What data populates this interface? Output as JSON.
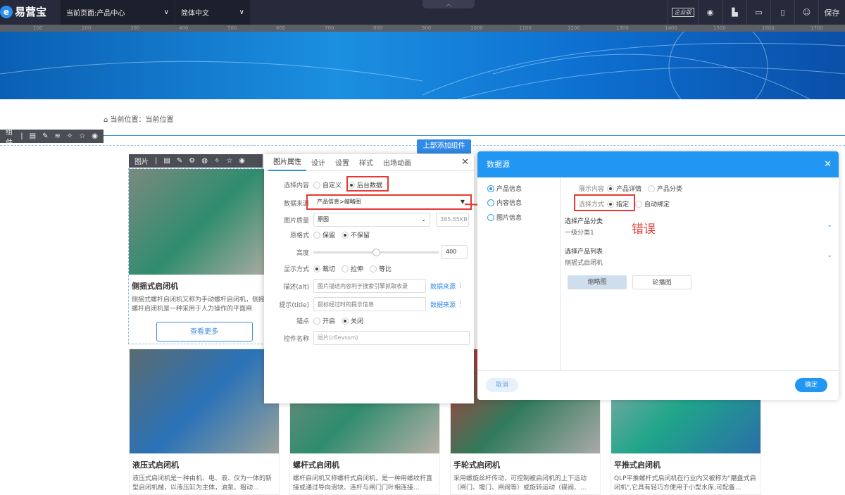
{
  "topbar": {
    "logo": "易营宝",
    "page_select": "当前页面:产品中心",
    "lang_select": "简体中文",
    "edition": "企业版",
    "save": "保存"
  },
  "ruler": [
    "100",
    "200",
    "300",
    "400",
    "500",
    "600",
    "700",
    "800",
    "900",
    "1000",
    "1100",
    "1200",
    "1300",
    "1400",
    "1500",
    "1600",
    "1700"
  ],
  "breadcrumb": "当前位置：当前位置",
  "component_toolbar": {
    "label": "组件"
  },
  "add_top_button": "上部添加组件",
  "image_toolbar": {
    "label": "图片"
  },
  "cards": [
    {
      "title": "侧摇式启闭机",
      "desc": "侧摇式螺杆启闭机又称为手动螺杆启闭机，侧摇式螺杆启闭机是一种采用于人力操作的平面闸",
      "more": "查看更多"
    },
    {
      "title": "液压式启闭机",
      "desc": "液压式启闭机是一种由机、电、液、仪为一体的新型启闭机械，以液压缸为主体，油泵、粗动..."
    },
    {
      "title": "螺杆式启闭机",
      "desc": "螺杆启闭机又称螺杆式启闭机，是一种用螺纹杆直接或通过导向滑块、连杆与闸门门叶相连接..."
    },
    {
      "title": "手轮式启闭机",
      "desc": "采用螺旋丝杆传动，可控制被启闭机的上下运动（闸门、堰门、闸阀等）或旋转运动（碟阀、..."
    },
    {
      "title": "平推式启闭机",
      "desc": "QLP平推螺杆式启闭机在行业内又被称为\"磨盘式启闭机\",它具有轻巧方便用于小型水库,可配备..."
    }
  ],
  "panel": {
    "tabs": [
      "图片属性",
      "设计",
      "设置",
      "样式",
      "出场动画"
    ],
    "content_label": "选择内容",
    "content_opts": [
      "自定义",
      "后台数据"
    ],
    "source_label": "数据来源",
    "source_value": "产品信息>缩略图",
    "quality_label": "图片质量",
    "quality_value": "原图",
    "size": "385.55KB",
    "format_label": "原格式",
    "format_opts": [
      "保留",
      "不保留"
    ],
    "height_label": "高度",
    "height_value": "400",
    "height_fraction": 0.5,
    "display_label": "显示方式",
    "display_opts": [
      "裁切",
      "拉伸",
      "等比"
    ],
    "alt_label": "描述(alt)",
    "alt_placeholder": "图片描述内容利于搜索引擎抓取收录",
    "title_label": "提示(title)",
    "title_placeholder": "鼠标经过时的提示信息",
    "link_source": "数据来源",
    "anchor_label": "锚点",
    "anchor_opts": [
      "开启",
      "关闭"
    ],
    "name_label": "控件名称",
    "name_value": "图片(c6evssm)"
  },
  "dialog": {
    "title": "数据源",
    "left_opts": [
      "产品信息",
      "内容信息",
      "图片信息"
    ],
    "show_label": "展示内容",
    "show_opts": [
      "产品详情",
      "产品分类"
    ],
    "mode_label": "选择方式",
    "mode_opts": [
      "指定",
      "自动绑定"
    ],
    "cat_label": "选择产品分类",
    "cat_value": "一级分类1",
    "list_label": "选择产品列表",
    "list_value": "侧摇式启闭机",
    "btn_thumb": "缩略图",
    "btn_carousel": "轮播图",
    "cancel": "取消",
    "ok": "确定",
    "error_note": "错误"
  }
}
